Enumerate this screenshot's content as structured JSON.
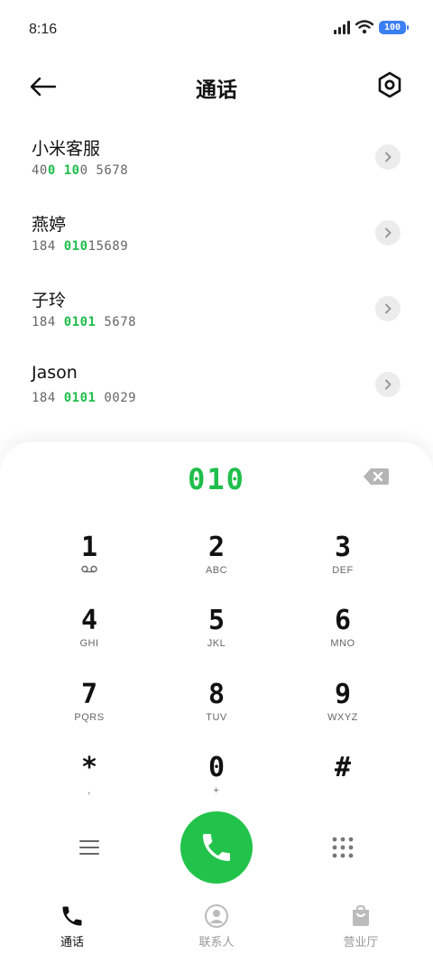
{
  "status_bar": {
    "time": "8:16",
    "battery": "100"
  },
  "header": {
    "title": "通话",
    "back_icon": "arrow-left-icon",
    "settings_icon": "hexagon-settings-icon"
  },
  "results": [
    {
      "name": "小米客服",
      "number_parts": [
        "40",
        "0 10",
        "0 5678"
      ]
    },
    {
      "name": "燕婷",
      "number_parts": [
        "184 ",
        "010",
        "15689"
      ]
    },
    {
      "name": "子玲",
      "number_parts": [
        "184 ",
        "0101",
        " 5678"
      ]
    },
    {
      "name": "Jason",
      "number_parts": [
        "184 ",
        "0101",
        " 0029"
      ]
    }
  ],
  "dialpad": {
    "input": "010",
    "keys": [
      {
        "digit": "1",
        "sub": ""
      },
      {
        "digit": "2",
        "sub": "ABC"
      },
      {
        "digit": "3",
        "sub": "DEF"
      },
      {
        "digit": "4",
        "sub": "GHI"
      },
      {
        "digit": "5",
        "sub": "JKL"
      },
      {
        "digit": "6",
        "sub": "MNO"
      },
      {
        "digit": "7",
        "sub": "PQRS"
      },
      {
        "digit": "8",
        "sub": "TUV"
      },
      {
        "digit": "9",
        "sub": "WXYZ"
      },
      {
        "digit": "*",
        "sub": ","
      },
      {
        "digit": "0",
        "sub": "+"
      },
      {
        "digit": "#",
        "sub": ""
      }
    ]
  },
  "bottom_nav": [
    {
      "label": "通话",
      "icon": "phone-icon",
      "active": true
    },
    {
      "label": "联系人",
      "icon": "contact-icon",
      "active": false
    },
    {
      "label": "营业厅",
      "icon": "store-bag-icon",
      "active": false
    }
  ],
  "colors": {
    "accent": "#1fbe4b",
    "call_button": "#22c34a",
    "battery": "#3b7ff5"
  }
}
